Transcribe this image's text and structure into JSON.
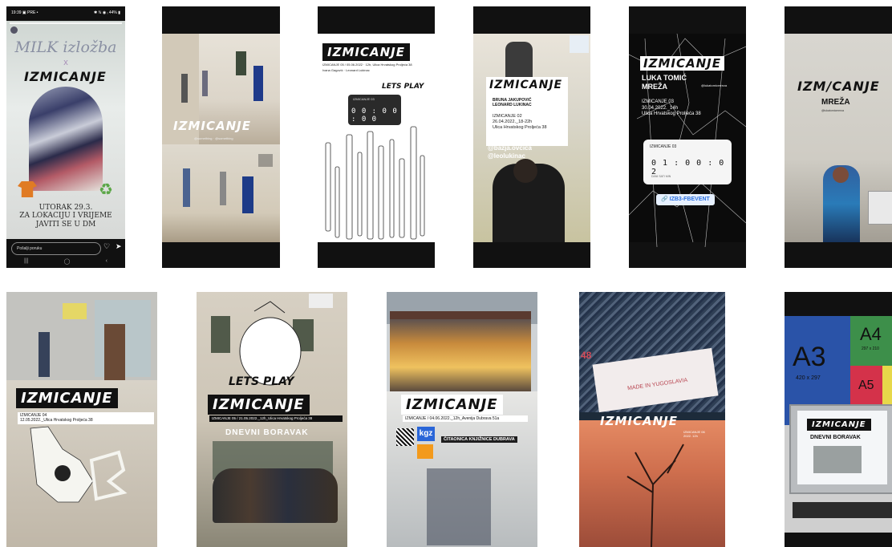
{
  "brand": "IZMICANJE",
  "row1": {
    "t1": {
      "status": "19:39 ▣ PRE •",
      "status_right": "✱ ℕ ◉ ᵢ 44% ▮",
      "headline": "MILK izložba",
      "x": "x",
      "logo": "IZMICANJE",
      "caption": "UTORAK 29.3.\nZA LOKACIJU I VRIJEME\nJAVITI SE U DM",
      "reply_placeholder": "Pošalji poruku",
      "nav": [
        "|||",
        "◯",
        "‹"
      ]
    },
    "t2": {
      "logo": "IZMICANJE",
      "small": "@something  ·  @something"
    },
    "t3": {
      "logo": "IZMICANJE",
      "sub": "IZMICANJE 05 / 05.06.2022 · 12h, Ulica Hrvatskog Proljeća 38",
      "names": "Ivana Gagović · Leonard Lukinac",
      "lets_play": "LETS PLAY",
      "timer_label": "IZMICANJE 03",
      "timer_value": "0 0 : 0 0 : 0 0"
    },
    "t4": {
      "logo": "IZMICANJE",
      "names": "BRUNA JAKUPOVIĆ\nLEONARD LUKINAC",
      "info": "IZMICANJE 02\n26.04.2022._18-22h\nUlica Hrvatskog Proljeća 38",
      "handles": "@bazja.ovcica\n@leolukinac"
    },
    "t5": {
      "logo": "IZMICANJE",
      "names": "LUKA TOMIĆ\nMREŽA",
      "handle": "@lukatomicmreza",
      "info": "IZMICANJE 03\n30.04.2022._14h\nUlica Hrvatskog Proljeća 38",
      "timer_label": "IZMICANJE 03",
      "timer_value": "0 1 : 0 0 : 0 2",
      "timer_units": "DANI    SATI    MIN",
      "link": "🔗 IZB3-FBEVENT"
    },
    "t6": {
      "logo": "IZM/CANJE",
      "title": "MREŽA",
      "small": "@lukatomicmreza"
    }
  },
  "row2": {
    "t1": {
      "logo": "IZMICANJE",
      "info": "IZMICANJE 04\n12.05.2022._Ulica Hrvatskog Proljeća 38"
    },
    "t2": {
      "lets_play": "LETS PLAY",
      "logo": "IZMICANJE",
      "info": "IZMICANJE 05 / 21.05.2022._12h_Ulica Hrvatskog Proljeća 38",
      "title": "DNEVNI BORAVAK"
    },
    "t3": {
      "logo": "IZMICANJE",
      "info": "IZMICANJE / 04.06.2022._12h_Avenija Dubrava 51a",
      "kgz": "kgz",
      "library": "ČITAONICA KNJIŽNICE DUBRAVA"
    },
    "t4": {
      "logo": "IZMICANJE",
      "made": "MADE IN YUGOSLAVIA",
      "num": "48",
      "small": "IZMICANJE 06\n2022. 12h"
    },
    "t5": {
      "a3": "A3",
      "a3_size": "420 x 297",
      "a4": "A4",
      "a4_size": "297 x 210",
      "a5": "A5",
      "screen_logo": "IZMICANJE",
      "screen_title": "DNEVNI BORAVAK"
    }
  }
}
